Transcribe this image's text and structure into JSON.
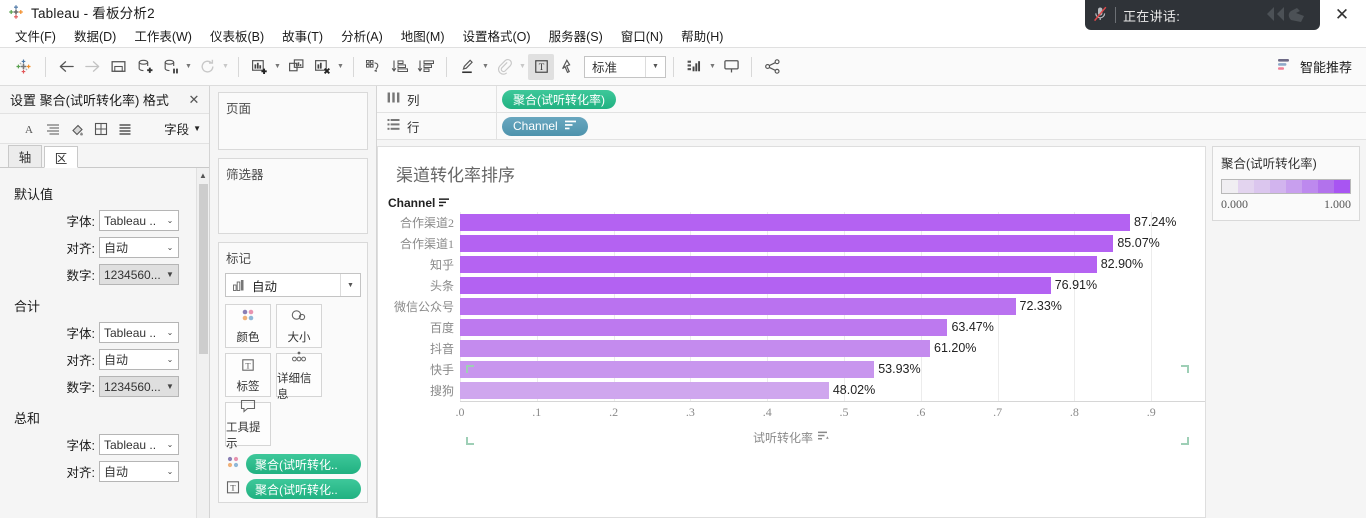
{
  "window": {
    "app_title": "Tableau - 看板分析2",
    "close_label": "✕"
  },
  "video_overlay": {
    "status": "正在讲话:",
    "mic_icon": "microphone-muted-icon",
    "reaction_icon": "wave-hand-icon"
  },
  "menu": [
    {
      "label": "文件(F)"
    },
    {
      "label": "数据(D)"
    },
    {
      "label": "工作表(W)"
    },
    {
      "label": "仪表板(B)"
    },
    {
      "label": "故事(T)"
    },
    {
      "label": "分析(A)"
    },
    {
      "label": "地图(M)"
    },
    {
      "label": "设置格式(O)"
    },
    {
      "label": "服务器(S)"
    },
    {
      "label": "窗口(N)"
    },
    {
      "label": "帮助(H)"
    }
  ],
  "toolbar": {
    "fit_value": "标准",
    "smart_recommend_label": "智能推荐",
    "icons": [
      "tableau-logo-icon",
      "back-arrow-icon",
      "forward-arrow-icon",
      "save-icon",
      "new-data-source-icon",
      "pause-data-updates-icon",
      "refresh-data-source-icon",
      "new-worksheet-icon",
      "duplicate-sheet-icon",
      "clear-sheet-icon",
      "swap-rows-columns-icon",
      "sort-ascending-icon",
      "sort-descending-icon",
      "highlight-icon",
      "group-members-icon",
      "show-mark-labels-icon",
      "fix-axes-icon",
      "show-hide-cards-icon",
      "presentation-mode-icon",
      "share-icon"
    ]
  },
  "format_pane": {
    "title": "设置 聚合(试听转化率) 格式",
    "field_label": "字段",
    "toolbar_icons": [
      "font-icon",
      "alignment-icon",
      "shading-icon",
      "borders-icon",
      "lines-icon"
    ],
    "tabs": [
      {
        "label": "轴",
        "selected": false
      },
      {
        "label": "区",
        "selected": true
      }
    ],
    "sections": [
      {
        "title": "默认值",
        "rows": [
          {
            "label": "字体:",
            "value": "Tableau ..",
            "style": "white"
          },
          {
            "label": "对齐:",
            "value": "自动",
            "style": "white"
          },
          {
            "label": "数字:",
            "value": "1234560...",
            "style": "grey"
          }
        ]
      },
      {
        "title": "合计",
        "rows": [
          {
            "label": "字体:",
            "value": "Tableau ..",
            "style": "white"
          },
          {
            "label": "对齐:",
            "value": "自动",
            "style": "white"
          },
          {
            "label": "数字:",
            "value": "1234560...",
            "style": "grey"
          }
        ]
      },
      {
        "title": "总和",
        "rows": [
          {
            "label": "字体:",
            "value": "Tableau ..",
            "style": "white"
          },
          {
            "label": "对齐:",
            "value": "自动",
            "style": "white"
          }
        ]
      }
    ]
  },
  "cards": {
    "pages_title": "页面",
    "filters_title": "筛选器",
    "marks_title": "标记",
    "marks_type": "自动",
    "mark_buttons": [
      {
        "label": "颜色",
        "icon": "color-palette-icon"
      },
      {
        "label": "大小",
        "icon": "size-circles-icon"
      },
      {
        "label": "标签",
        "icon": "text-label-icon"
      },
      {
        "label": "详细信息",
        "icon": "detail-dots-icon"
      },
      {
        "label": "工具提示",
        "icon": "tooltip-bubble-icon"
      }
    ],
    "mark_pills": [
      {
        "icon": "color-palette-icon",
        "label": "聚合(试听转化.."
      },
      {
        "icon": "text-label-icon",
        "label": "聚合(试听转化.."
      }
    ]
  },
  "shelves": [
    {
      "name": "列",
      "icon": "columns-icon",
      "pill": {
        "label": "聚合(试听转化率)",
        "type": "measure"
      }
    },
    {
      "name": "行",
      "icon": "rows-icon",
      "pill": {
        "label": "Channel",
        "type": "dimension",
        "sorted": true
      }
    }
  ],
  "legend": {
    "title": "聚合(试听转化率)",
    "min": "0.000",
    "max": "1.000",
    "ramp": [
      "#f0eef2",
      "#e3d4ef",
      "#dbc6ee",
      "#d2b4ee",
      "#c89fee",
      "#bd89ee",
      "#b272ec",
      "#a855f2"
    ]
  },
  "chart_data": {
    "type": "bar",
    "title": "渠道转化率排序",
    "row_header": "Channel",
    "xlabel": "试听转化率",
    "ylabel": "",
    "orientation": "horizontal",
    "xlim": [
      0,
      0.97
    ],
    "grid": true,
    "legend_position": "right",
    "x_tick_labels": [
      ".0",
      ".1",
      ".2",
      ".3",
      ".4",
      ".5",
      ".6",
      ".7",
      ".8",
      ".9"
    ],
    "x_tick_values": [
      0.0,
      0.1,
      0.2,
      0.3,
      0.4,
      0.5,
      0.6,
      0.7,
      0.8,
      0.9
    ],
    "categories": [
      "合作渠道2",
      "合作渠道1",
      "知乎",
      "头条",
      "微信公众号",
      "百度",
      "抖音",
      "快手",
      "搜狗"
    ],
    "values": [
      0.8724,
      0.8507,
      0.829,
      0.7691,
      0.7233,
      0.6347,
      0.612,
      0.5393,
      0.4802
    ],
    "labels": [
      "87.24%",
      "85.07%",
      "82.90%",
      "76.91%",
      "72.33%",
      "63.47%",
      "61.20%",
      "53.93%",
      "48.02%"
    ],
    "colors": [
      "#b462f2",
      "#b462f2",
      "#b563f2",
      "#b362f2",
      "#ba72f0",
      "#bd79ef",
      "#c48bee",
      "#c896ee",
      "#cfa6ee"
    ]
  }
}
